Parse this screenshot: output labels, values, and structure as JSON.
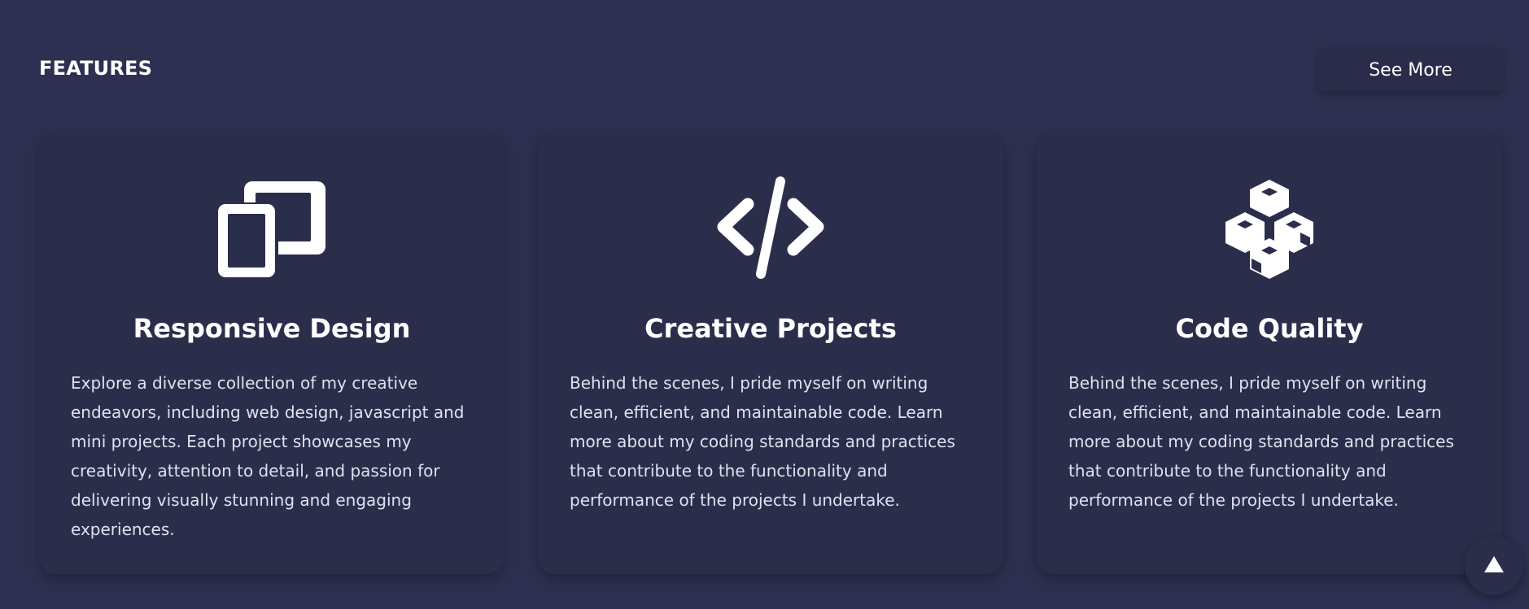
{
  "section": {
    "title": "FEATURES",
    "see_more_label": "See More"
  },
  "cards": [
    {
      "icon": "devices-icon",
      "title": "Responsive Design",
      "text": "Explore a diverse collection of my creative endeavors, including web design, javascript and mini projects. Each project showcases my creativity, attention to detail, and passion for delivering visually stunning and engaging experiences."
    },
    {
      "icon": "code-icon",
      "title": "Creative Projects",
      "text": "Behind the scenes, I pride myself on writing clean, efficient, and maintainable code. Learn more about my coding standards and practices that contribute to the functionality and performance of the projects I undertake."
    },
    {
      "icon": "cubes-icon",
      "title": "Code Quality",
      "text": "Behind the scenes, I pride myself on writing clean, efficient, and maintainable code. Learn more about my coding standards and practices that contribute to the functionality and performance of the projects I undertake."
    }
  ],
  "scroll_top": {
    "icon": "arrow-up-icon"
  },
  "colors": {
    "background": "#2d3050",
    "card": "#2b2e4b",
    "text": "#dfe1ee",
    "heading": "#ffffff"
  }
}
